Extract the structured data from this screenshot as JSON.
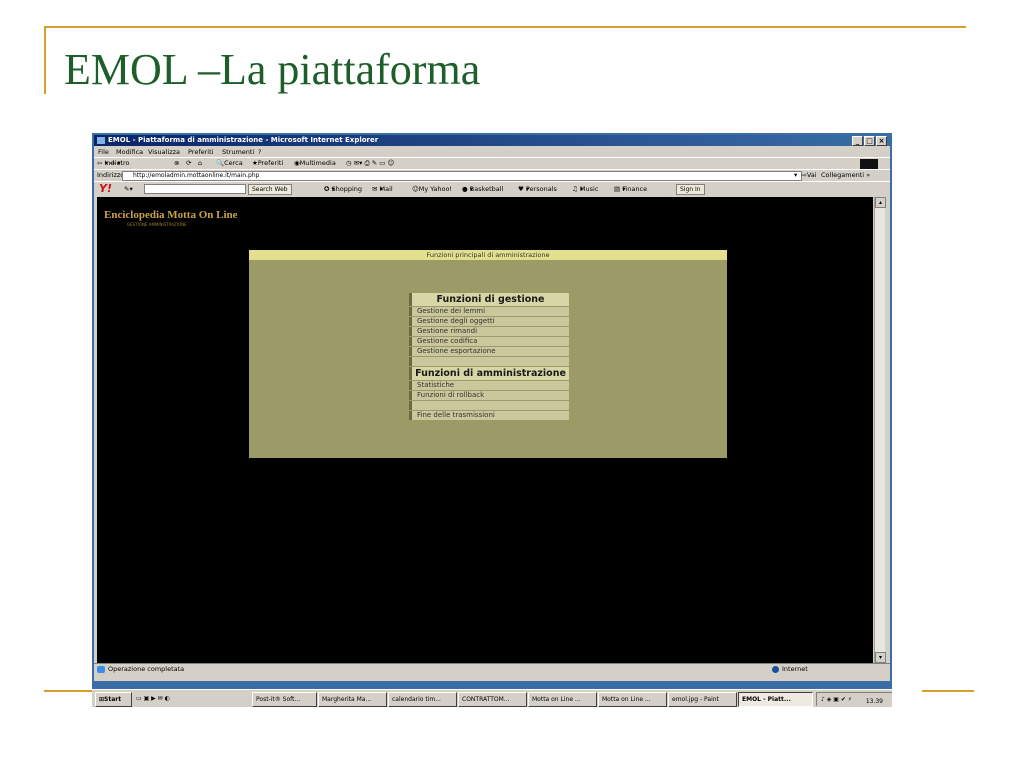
{
  "slide": {
    "title": "EMOL –La piattaforma",
    "accent_color": "#d6a02b",
    "title_color": "#1d5e2a"
  },
  "browser": {
    "window_title": "EMOL - Piattaforma di amministrazione - Microsoft Internet Explorer",
    "menu": [
      "File",
      "Modifica",
      "Visualizza",
      "Preferiti",
      "Strumenti",
      "?"
    ],
    "toolbar": {
      "back": "Indietro",
      "search": "Cerca",
      "favorites": "Preferiti",
      "multimedia": "Multimedia"
    },
    "address_label": "Indirizzo",
    "address": "http://emoladmin.mottaonline.it/main.php",
    "go_label": "Vai",
    "links_label": "Collegamenti",
    "yahoo": {
      "logo": "Y!",
      "search_button": "Search Web",
      "items": [
        "Shopping",
        "Mail",
        "My Yahoo!",
        "Basketball",
        "Personals",
        "Music",
        "Finance"
      ],
      "sign_in": "Sign In"
    },
    "status": "Operazione completata",
    "zone": "Internet"
  },
  "site": {
    "logo": "Enciclopedia Motta On Line",
    "logo_sub": "GESTIONE AMMINISTRAZIONE"
  },
  "panel": {
    "header": "Funzioni principali di amministrazione",
    "gestione_title": "Funzioni di gestione",
    "gestione_items": [
      "Gestione dei lemmi",
      "Gestione degli oggetti",
      "Gestione rimandi",
      "Gestione codifica",
      "Gestione esportazione"
    ],
    "amministrazione_title": "Funzioni di amministrazione",
    "amministrazione_items": [
      "Statistiche",
      "Funzioni di rollback"
    ],
    "exit_item": "Fine delle trasmissioni"
  },
  "taskbar": {
    "start": "Start",
    "tasks": [
      "Post-it® Soft...",
      "Margherita Ma...",
      "calendario tim...",
      "CONTRATTOM...",
      "Motta on Line ...",
      "Motta on Line ...",
      "emol.jpg - Paint",
      "EMOL - Piatt..."
    ],
    "clock": "13.39"
  }
}
